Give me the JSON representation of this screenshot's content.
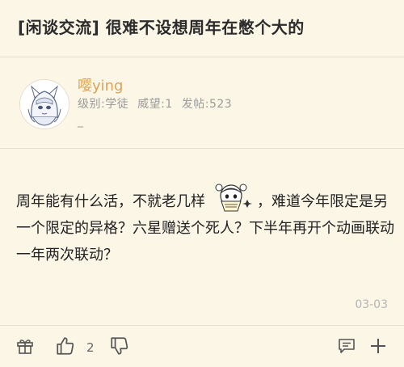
{
  "header": {
    "title": "[闲谈交流] 很难不设想周年在憋个大的"
  },
  "author": {
    "username": "嘤ying",
    "level": "级别:学徒",
    "prestige": "威望:1",
    "posts": "发帖:523",
    "signature": "_"
  },
  "post": {
    "text_before": "周年能有什么活，不就老几样",
    "text_after": "，难道今年限定是另一个限定的异格？六星赠送个死人？下半年再开个动画联动一年两次联动？",
    "date": "03-03"
  },
  "actions": {
    "like_count": "2"
  },
  "icons": {
    "gift": "gift-icon",
    "like": "thumbs-up-icon",
    "dislike": "thumbs-down-icon",
    "comment": "comment-icon",
    "more": "plus-icon"
  },
  "colors": {
    "background": "#fbf6e6",
    "username": "#d9a45a",
    "meta": "#9b9b9b",
    "divider": "#e6dfcb"
  }
}
